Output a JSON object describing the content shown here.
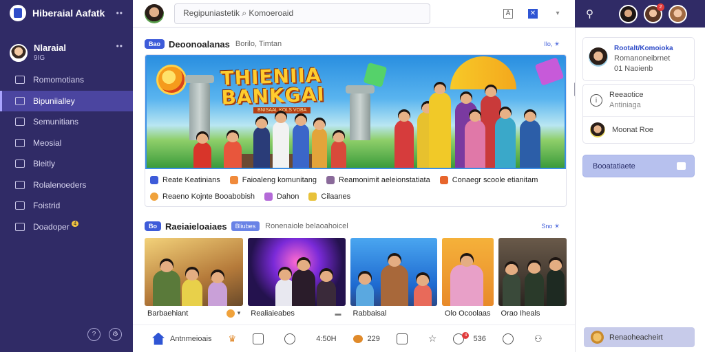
{
  "app": {
    "brand": "Hiberaial Aafatk"
  },
  "profile": {
    "name": "Nlaraial",
    "sub": "9IG"
  },
  "nav": [
    {
      "label": "Romomotians",
      "icon": "home-icon"
    },
    {
      "label": "Bipuniialley",
      "icon": "play-icon",
      "active": true
    },
    {
      "label": "Semunitians",
      "icon": "list-icon"
    },
    {
      "label": "Meosial",
      "icon": "document-icon"
    },
    {
      "label": "Bleitly",
      "icon": "square-icon"
    },
    {
      "label": "Rolalenoeders",
      "icon": "people-icon"
    },
    {
      "label": "Foistrid",
      "icon": "power-icon"
    },
    {
      "label": "Doadoper",
      "icon": "lock-icon",
      "badge": "4"
    }
  ],
  "search": {
    "value": "Regipuniastetik",
    "placeholder": "Komoeroaid"
  },
  "section1": {
    "pill": "Bao",
    "title": "Deoonoalanas",
    "sub": "Borilo, Timtan",
    "link": "Ilo, ☀"
  },
  "banner": {
    "title_line1": "THIENIIA",
    "title_line2": "BANKGAI",
    "subline": "BNISAAL KOLS VOBA"
  },
  "feature_tags": [
    [
      {
        "label": "Reate Keatinians",
        "color": "#3d5bd9"
      },
      {
        "label": "Faioaleng komunitang",
        "color": "#f08a3b"
      },
      {
        "label": "Reamonimit aeleionstatiata",
        "color": "#8a6a9a"
      },
      {
        "label": "Conaegr scoole etianitam",
        "color": "#e7652c"
      }
    ],
    [
      {
        "label": "Reaeno Kojnte Booabobish",
        "color": "#f0a23b"
      },
      {
        "label": "Dahon",
        "color": "#b46ad8"
      },
      {
        "label": "Cilaanes",
        "color": "#e8c23a"
      }
    ]
  ],
  "section2": {
    "pill": "Bo",
    "title": "Raeiaieloaiaes",
    "tag": "Bliubes",
    "sub": "Ronenaiole belaoahoicel",
    "link": "Sno ☀"
  },
  "video_cards": [
    {
      "label": "Barbaehiant",
      "meta": ""
    },
    {
      "label": "Realiaieabes",
      "meta": "▬"
    },
    {
      "label": "Rabbaisal",
      "meta": ""
    },
    {
      "label": "Olo Ocoolaas",
      "meta": ""
    },
    {
      "label": "Orao Iheals",
      "meta": ""
    }
  ],
  "bottombar": [
    {
      "label": "Antnmeioais",
      "icon": "home-icon"
    },
    {
      "label": "",
      "icon": "trophy-icon"
    },
    {
      "label": "",
      "icon": "edit-icon"
    },
    {
      "label": "",
      "icon": "chat-icon"
    },
    {
      "label": "4:50H",
      "icon": ""
    },
    {
      "label": "229",
      "icon": "coin-icon"
    },
    {
      "label": "",
      "icon": "message-icon"
    },
    {
      "label": "",
      "icon": "star-icon"
    },
    {
      "label": "536",
      "icon": "notification-icon",
      "badge": "4"
    },
    {
      "label": "",
      "icon": "clock-icon"
    },
    {
      "label": "",
      "icon": "user-icon"
    }
  ],
  "right": {
    "card1": {
      "title": "Rootalt/Komoioka",
      "line1": "Romanoneibrnet",
      "line2": "01 Naoienb"
    },
    "card2": {
      "row1_a": "Reeaotice",
      "row1_b": "Antiniaga",
      "row2": "Moonat Roe"
    },
    "button": "Booatatiaete",
    "bottom": "Renaoheacheirt",
    "avatar_badge": "2"
  },
  "colors": {
    "sidebar": "#302b66",
    "accent": "#3d5bd9",
    "active_nav": "#4b45a0"
  }
}
